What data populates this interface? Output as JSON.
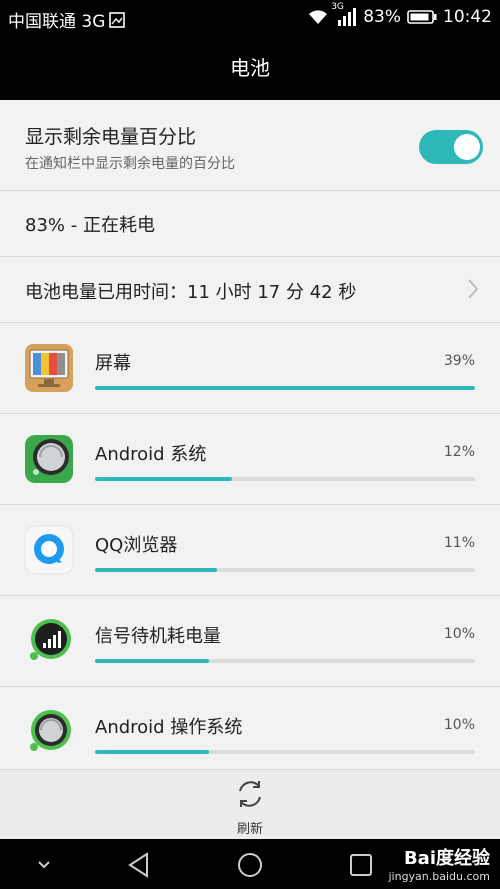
{
  "status_bar": {
    "carrier": "中国联通 3G",
    "network_badge": "3G",
    "battery_percent": "83%",
    "time": "10:42"
  },
  "title": "电池",
  "settings": {
    "show_percent_title": "显示剩余电量百分比",
    "show_percent_desc": "在通知栏中显示剩余电量的百分比",
    "toggle_on": true
  },
  "battery_status": "83% - 正在耗电",
  "usage_time": "电池电量已用时间：11 小时 17 分 42 秒",
  "apps": [
    {
      "name": "屏幕",
      "percent": "39%",
      "level": 1.0,
      "icon": "screen-icon"
    },
    {
      "name": "Android 系统",
      "percent": "12%",
      "level": 0.36,
      "icon": "android-system-icon"
    },
    {
      "name": "QQ浏览器",
      "percent": "11%",
      "level": 0.32,
      "icon": "qq-browser-icon"
    },
    {
      "name": "信号待机耗电量",
      "percent": "10%",
      "level": 0.3,
      "icon": "signal-standby-icon"
    },
    {
      "name": "Android 操作系统",
      "percent": "10%",
      "level": 0.3,
      "icon": "android-os-icon"
    }
  ],
  "refresh_label": "刷新",
  "watermark": {
    "main": "Bai度经验",
    "sub": "jingyan.baidu.com"
  },
  "colors": {
    "accent": "#2fb8b8",
    "bar_track": "#dcdcdc"
  }
}
